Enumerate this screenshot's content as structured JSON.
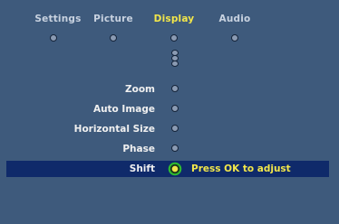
{
  "tabs": [
    {
      "label": "Settings"
    },
    {
      "label": "Picture"
    },
    {
      "label": "Display"
    },
    {
      "label": "Audio"
    }
  ],
  "menu_items": [
    {
      "label": "Zoom"
    },
    {
      "label": "Auto Image"
    },
    {
      "label": "Horizontal Size"
    },
    {
      "label": "Phase"
    },
    {
      "label": "Shift"
    }
  ],
  "active_tab": "Display",
  "selected_item": "Shift",
  "hint": "Press OK to adjust",
  "colors": {
    "background": "#3e5a7c",
    "highlight": "#0f2a6a",
    "accent": "#f2e64a",
    "selected_ring": "#2fbf2f"
  }
}
